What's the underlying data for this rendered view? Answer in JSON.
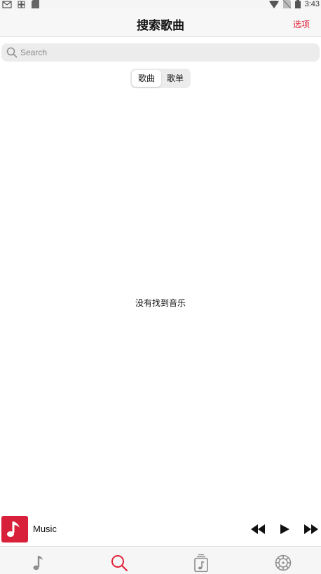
{
  "status_bar": {
    "time": "3:43",
    "icons": [
      "mail-icon",
      "grid-icon",
      "sd-card-icon",
      "wifi-icon",
      "no-sim-icon",
      "battery-icon"
    ]
  },
  "header": {
    "title": "搜索歌曲",
    "options_label": "选项"
  },
  "search": {
    "placeholder": "Search",
    "value": ""
  },
  "segmented_control": {
    "items": [
      {
        "label": "歌曲",
        "selected": true
      },
      {
        "label": "歌单",
        "selected": false
      }
    ]
  },
  "empty_state": {
    "message": "没有找到音乐"
  },
  "mini_player": {
    "title": "Music",
    "controls": [
      "rewind-icon",
      "play-icon",
      "fast-forward-icon"
    ]
  },
  "tab_bar": {
    "tabs": [
      {
        "icon": "music-note-icon",
        "selected": false
      },
      {
        "icon": "search-icon",
        "selected": true
      },
      {
        "icon": "playlist-icon",
        "selected": false
      },
      {
        "icon": "settings-gear-icon",
        "selected": false
      }
    ]
  },
  "colors": {
    "accent": "#e0243a",
    "art_background": "#d8203a",
    "icon_gray": "#8e8e8e",
    "search_background": "#ececec"
  }
}
